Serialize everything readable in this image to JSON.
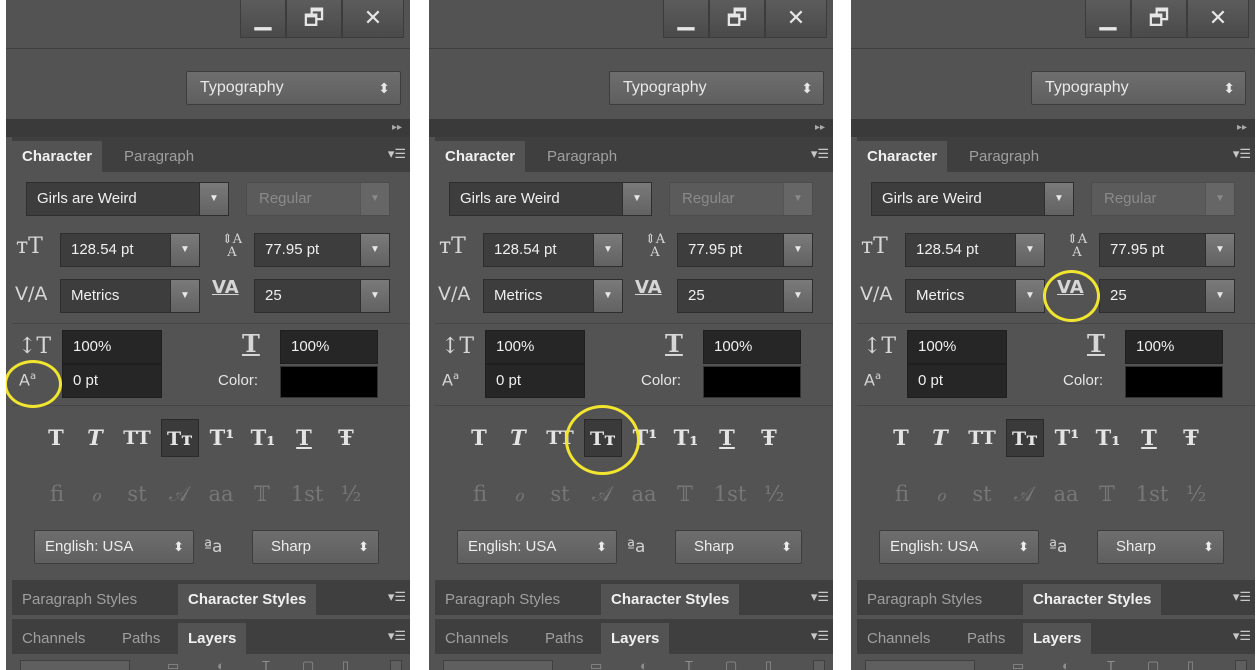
{
  "window_buttons": {
    "minimize": "▁",
    "restore": "🗗",
    "close": "✕"
  },
  "workspace": {
    "label": "Typography",
    "arrow": "⬍"
  },
  "collapse_icon": "▸▸",
  "character_panel": {
    "tabs": [
      "Character",
      "Paragraph"
    ],
    "font_family": "Girls are Weird",
    "font_style": "Regular",
    "font_size": "128.54 pt",
    "leading": "77.95 pt",
    "kerning": "Metrics",
    "tracking": "25",
    "vertical_scale": "100%",
    "horizontal_scale": "100%",
    "baseline_shift": "0 pt",
    "color_label": "Color:",
    "color_value": "#000000",
    "type_styles": [
      "T",
      "T",
      "TT",
      "Tт",
      "T¹",
      "T₁",
      "T",
      "Ŧ"
    ],
    "opentype_styles": [
      "ﬁ",
      "ℴ",
      "st",
      "𝒜",
      "aa",
      "𝕋",
      "1st",
      "½"
    ],
    "language": "English: USA",
    "antialias_icon": "ªa",
    "antialias": "Sharp"
  },
  "styles_panel": {
    "tabs": [
      "Paragraph Styles",
      "Character Styles"
    ]
  },
  "layers_panel": {
    "tabs": [
      "Channels",
      "Paths",
      "Layers"
    ]
  },
  "highlight_color": "#f2e530",
  "panels": [
    {
      "id": "left",
      "highlight": "baseline-shift-icon"
    },
    {
      "id": "middle",
      "highlight": "small-caps-button"
    },
    {
      "id": "right",
      "highlight": "tracking-icon"
    }
  ]
}
